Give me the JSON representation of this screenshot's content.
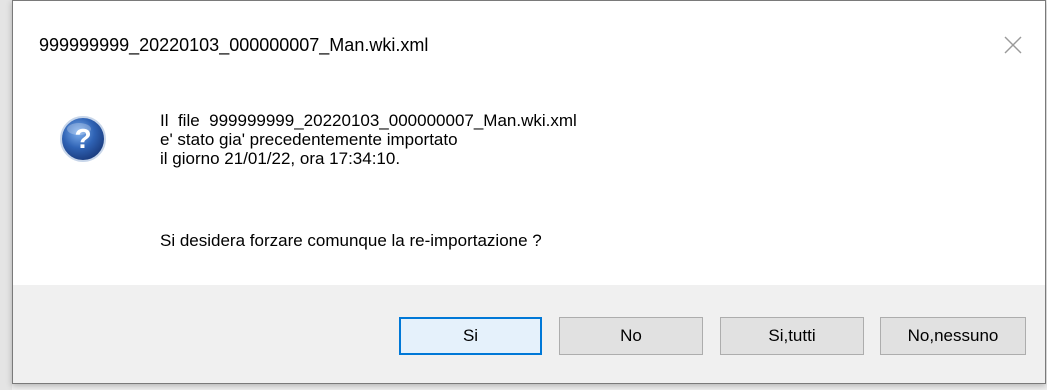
{
  "dialog": {
    "title": "999999999_20220103_000000007_Man.wki.xml",
    "close_icon": "close-icon",
    "icon": "question-icon",
    "message_lines": [
      "Il  file  999999999_20220103_000000007_Man.wki.xml",
      "e' stato gia' precedentemente importato",
      "il giorno 21/01/22, ora 17:34:10."
    ],
    "question": "Si desidera forzare comunque la re-importazione ?",
    "buttons": {
      "si": "Si",
      "no": "No",
      "si_tutti": "Si,tutti",
      "no_nessuno": "No,nessuno"
    },
    "colors": {
      "icon_blue": "#2f63b5",
      "default_button_border": "#0078d7",
      "footer_bg": "#f0f0f0"
    }
  }
}
